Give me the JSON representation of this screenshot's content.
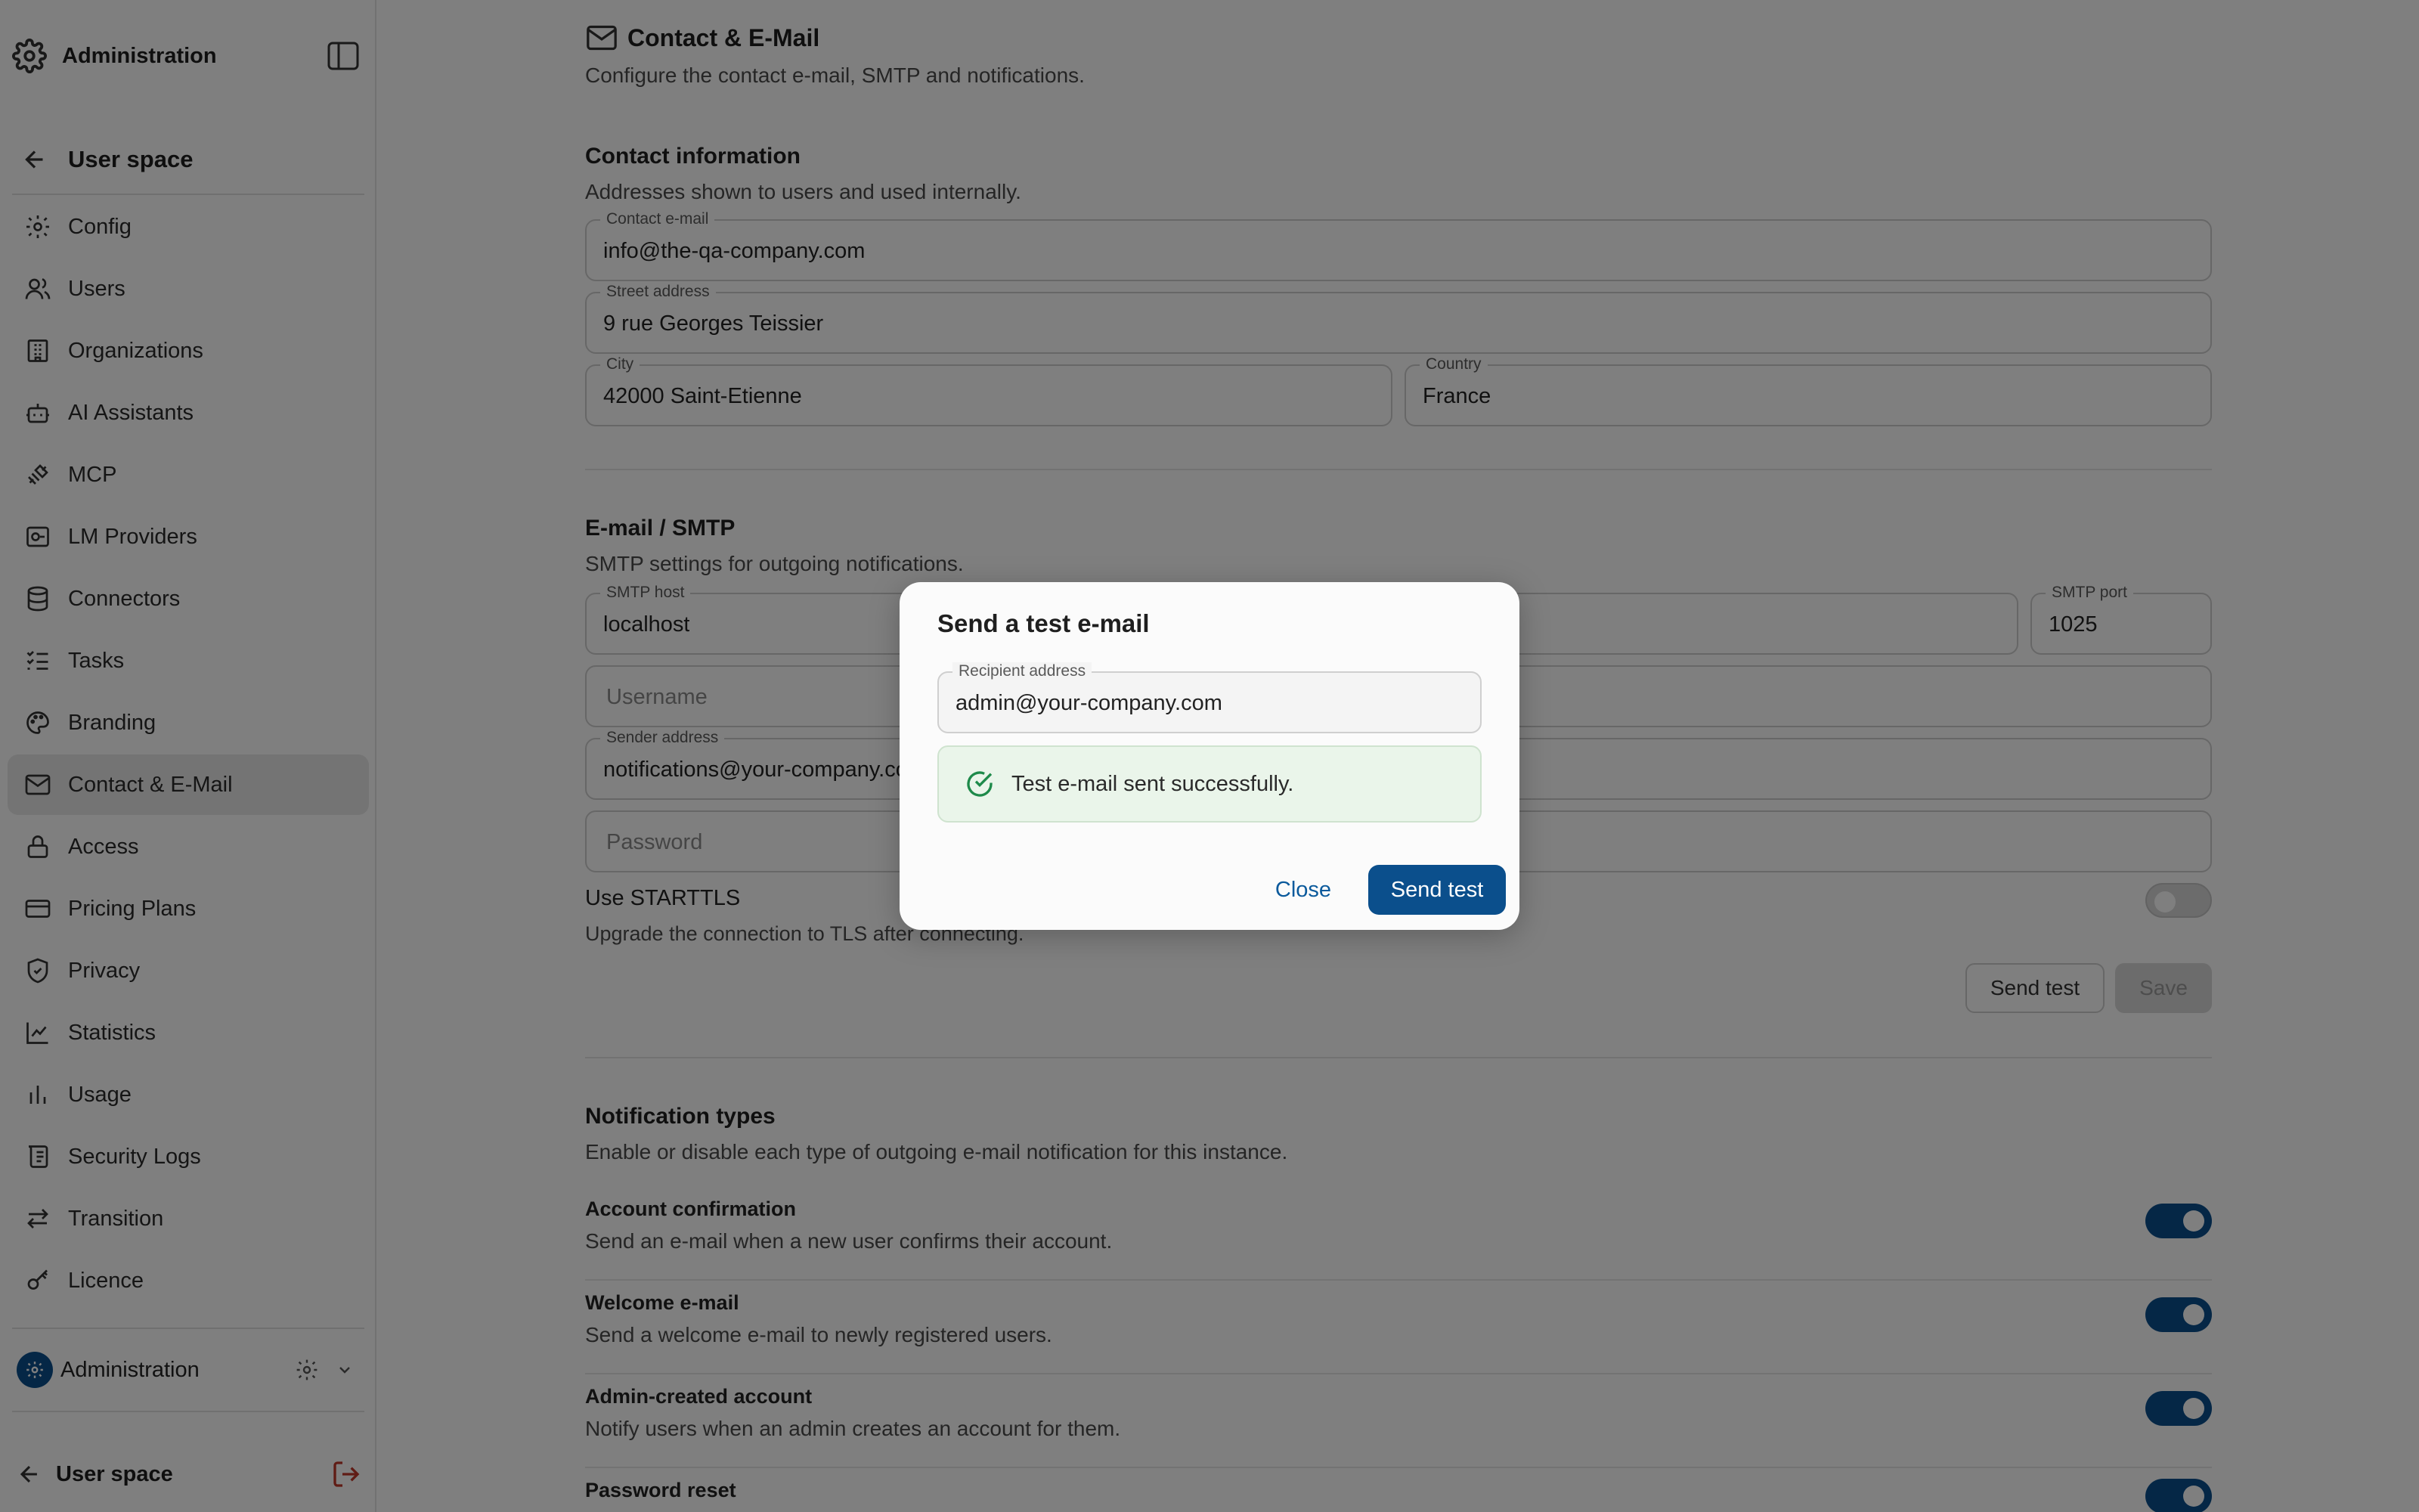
{
  "sidebar": {
    "title": "Administration",
    "back_label": "User space",
    "items": [
      {
        "label": "Config",
        "icon": "gear-icon"
      },
      {
        "label": "Users",
        "icon": "users-icon"
      },
      {
        "label": "Organizations",
        "icon": "building-icon"
      },
      {
        "label": "AI Assistants",
        "icon": "bot-icon"
      },
      {
        "label": "MCP",
        "icon": "plug-icon"
      },
      {
        "label": "LM Providers",
        "icon": "server-icon"
      },
      {
        "label": "Connectors",
        "icon": "database-icon"
      },
      {
        "label": "Tasks",
        "icon": "checklist-icon"
      },
      {
        "label": "Branding",
        "icon": "palette-icon"
      },
      {
        "label": "Contact & E-Mail",
        "icon": "mail-icon",
        "active": true
      },
      {
        "label": "Access",
        "icon": "lock-icon"
      },
      {
        "label": "Pricing Plans",
        "icon": "credit-card-icon"
      },
      {
        "label": "Privacy",
        "icon": "shield-icon"
      },
      {
        "label": "Statistics",
        "icon": "line-chart-icon"
      },
      {
        "label": "Usage",
        "icon": "bar-chart-icon"
      },
      {
        "label": "Security Logs",
        "icon": "scroll-icon"
      },
      {
        "label": "Transition",
        "icon": "arrows-icon"
      },
      {
        "label": "Licence",
        "icon": "key-icon"
      }
    ],
    "org_name": "Administration",
    "bottom_label": "User space"
  },
  "page": {
    "title": "Contact & E-Mail",
    "subtitle": "Configure the contact e-mail, SMTP and notifications."
  },
  "contact": {
    "title": "Contact information",
    "subtitle": "Addresses shown to users and used internally.",
    "email_label": "Contact e-mail",
    "email_value": "info@the-qa-company.com",
    "street_label": "Street address",
    "street_value": "9 rue Georges Teissier",
    "city_label": "City",
    "city_value": "42000 Saint-Etienne",
    "country_label": "Country",
    "country_value": "France"
  },
  "smtp": {
    "title": "E-mail / SMTP",
    "subtitle": "SMTP settings for outgoing notifications.",
    "host_label": "SMTP host",
    "host_value": "localhost",
    "port_label": "SMTP port",
    "port_value": "1025",
    "username_placeholder": "Username",
    "sender_label": "Sender address",
    "sender_value": "notifications@your-company.com",
    "password_placeholder": "Password",
    "starttls_label": "Use STARTTLS",
    "starttls_desc": "Upgrade the connection to TLS after connecting.",
    "starttls_on": false,
    "send_test_label": "Send test",
    "save_label": "Save"
  },
  "notifications": {
    "title": "Notification types",
    "subtitle": "Enable or disable each type of outgoing e-mail notification for this instance.",
    "items": [
      {
        "title": "Account confirmation",
        "desc": "Send an e-mail when a new user confirms their account.",
        "on": true
      },
      {
        "title": "Welcome e-mail",
        "desc": "Send a welcome e-mail to newly registered users.",
        "on": true
      },
      {
        "title": "Admin-created account",
        "desc": "Notify users when an admin creates an account for them.",
        "on": true
      },
      {
        "title": "Password reset",
        "desc": "",
        "on": true
      }
    ]
  },
  "modal": {
    "title": "Send a test e-mail",
    "recipient_label": "Recipient address",
    "recipient_value": "admin@your-company.com",
    "success_text": "Test e-mail sent successfully.",
    "close_label": "Close",
    "send_label": "Send test"
  },
  "colors": {
    "accent": "#0b4f8c",
    "link": "#0b5a9c",
    "success_bg": "#eaf5ea",
    "success_icon": "#1e8a4a",
    "logout": "#c0392b"
  }
}
